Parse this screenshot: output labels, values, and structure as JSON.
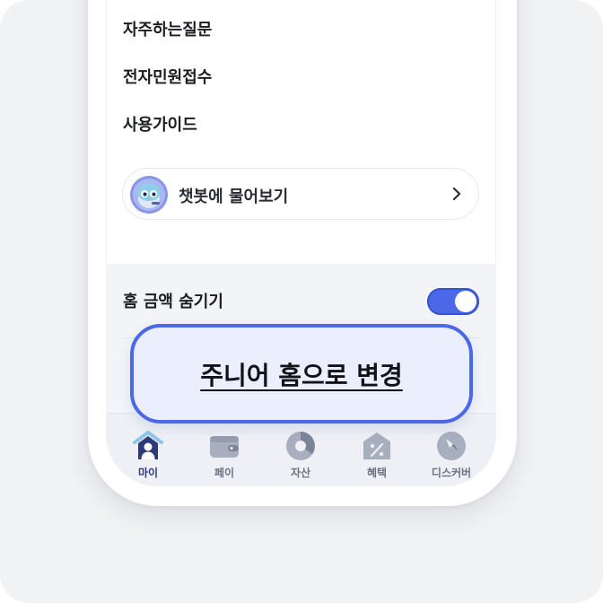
{
  "menu": {
    "items": [
      {
        "label": "자주하는질문"
      },
      {
        "label": "전자민원접수"
      },
      {
        "label": "사용가이드"
      }
    ]
  },
  "chatbot": {
    "label": "챗봇에 물어보기",
    "avatar_icon": "chatbot-mascot-icon",
    "chevron_icon": "chevron-right-icon"
  },
  "settings": {
    "hide_amount_label": "홈 금액 숨기기",
    "hide_amount_on": true
  },
  "junior_home": {
    "label": "주니어 홈으로 변경"
  },
  "tabbar": {
    "tabs": [
      {
        "label": "마이",
        "icon": "home-person-icon",
        "active": true
      },
      {
        "label": "페이",
        "icon": "wallet-icon",
        "active": false
      },
      {
        "label": "자산",
        "icon": "pie-chart-icon",
        "active": false
      },
      {
        "label": "혜택",
        "icon": "discount-tag-icon",
        "active": false
      },
      {
        "label": "디스커버",
        "icon": "compass-icon",
        "active": false
      }
    ]
  },
  "colors": {
    "accent": "#4a68e8",
    "background": "#f1f2f4",
    "tab_active": "#2c3a7a"
  }
}
